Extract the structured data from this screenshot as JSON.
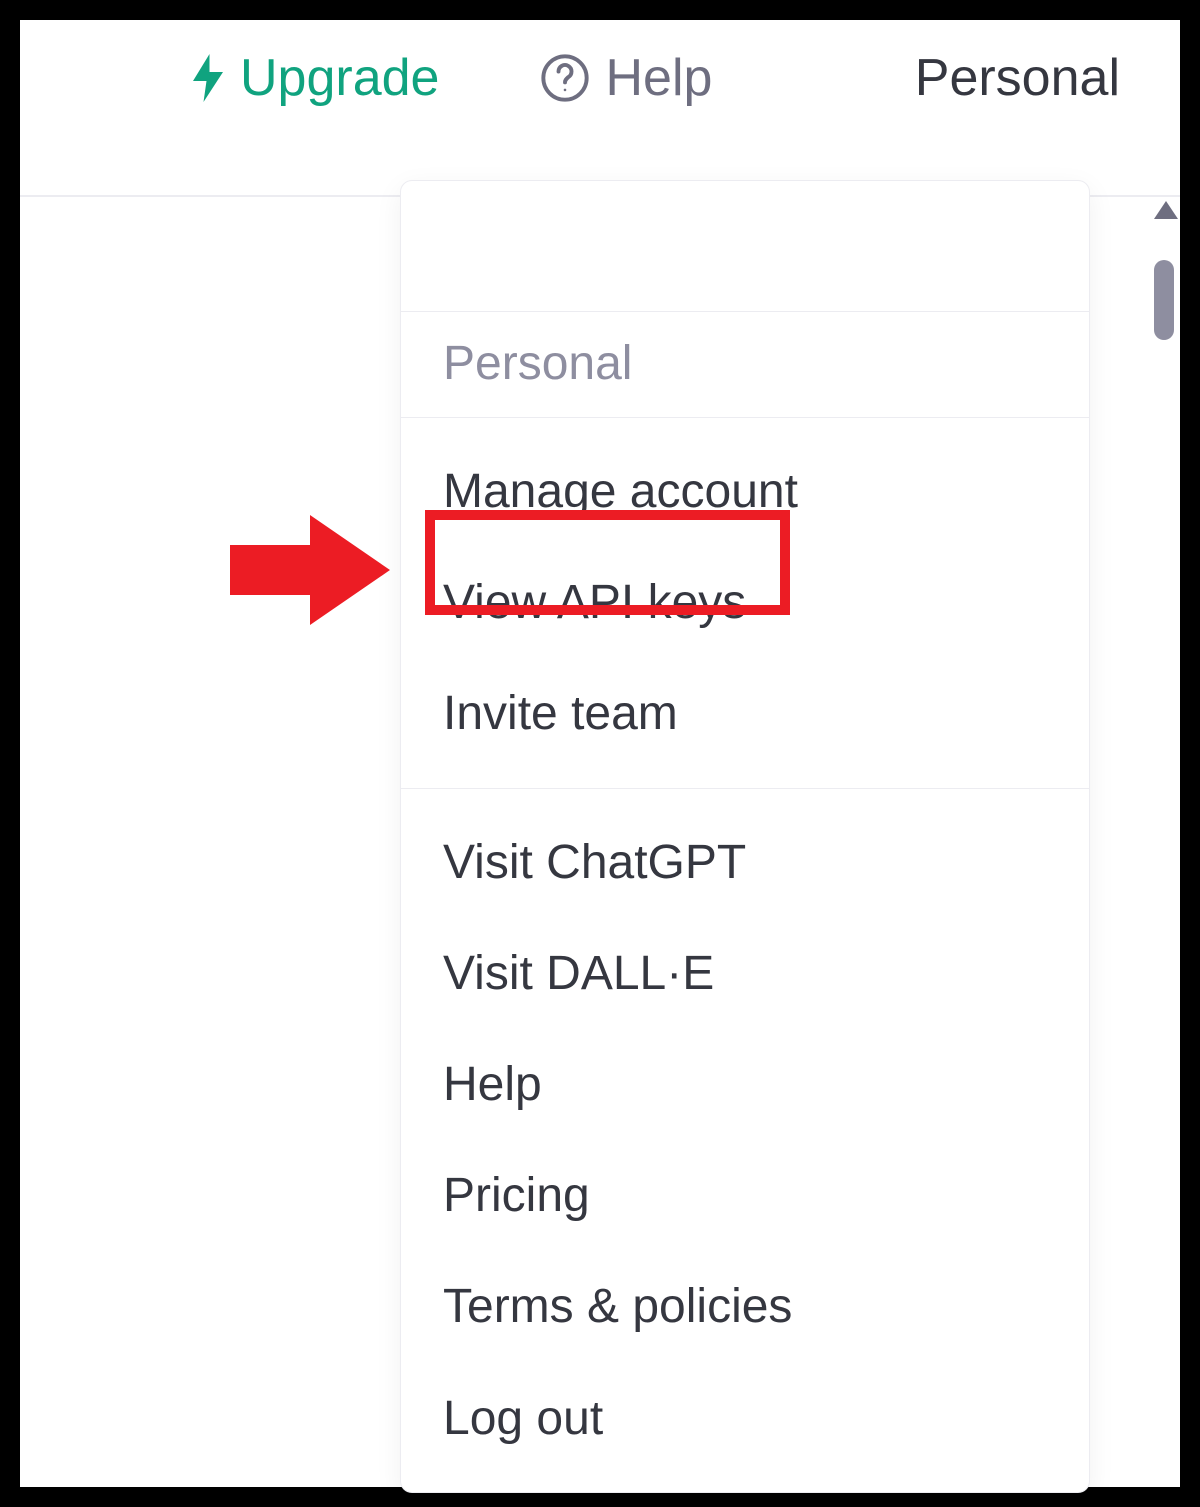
{
  "topbar": {
    "upgrade_label": "Upgrade",
    "help_label": "Help",
    "personal_label": "Personal"
  },
  "dropdown": {
    "section_title": "Personal",
    "group_account": [
      {
        "label": "Manage account"
      },
      {
        "label": "View API keys"
      },
      {
        "label": "Invite team"
      }
    ],
    "group_links": [
      {
        "label": "Visit ChatGPT"
      },
      {
        "label": "Visit DALL·E"
      },
      {
        "label": "Help"
      },
      {
        "label": "Pricing"
      },
      {
        "label": "Terms & policies"
      },
      {
        "label": "Log out"
      }
    ]
  },
  "annotation": {
    "highlighted_item_label": "View API keys",
    "colors": {
      "highlight_red": "#ec1c24",
      "accent_green": "#10a37f"
    }
  }
}
